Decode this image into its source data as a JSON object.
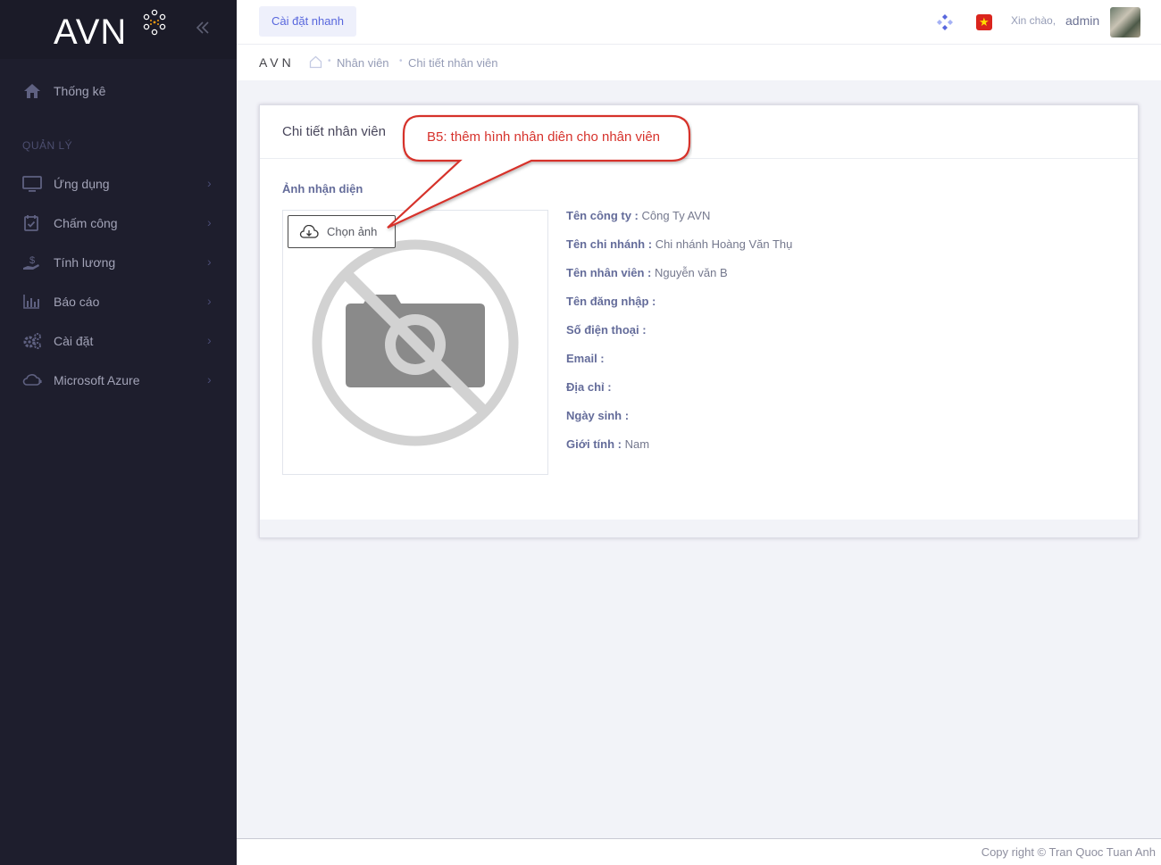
{
  "brand": {
    "name": "AVN"
  },
  "sidebar": {
    "items": [
      {
        "label": "Thống kê",
        "icon": "home-icon"
      },
      {
        "label": "Ứng dụng",
        "icon": "monitor-icon"
      },
      {
        "label": "Chấm công",
        "icon": "calendar-check-icon"
      },
      {
        "label": "Tính lương",
        "icon": "hand-money-icon"
      },
      {
        "label": "Báo cáo",
        "icon": "bar-chart-icon"
      },
      {
        "label": "Cài đặt",
        "icon": "gears-icon"
      },
      {
        "label": "Microsoft Azure",
        "icon": "cloud-icon"
      }
    ],
    "section_label": "QUẢN LÝ"
  },
  "header": {
    "quick_settings": "Cài đặt nhanh",
    "greeting": "Xin chào,",
    "username": "admin"
  },
  "subheader": {
    "title": "AVN",
    "breadcrumbs": [
      "Nhân viên",
      "Chi tiết nhân viên"
    ]
  },
  "portlet": {
    "title": "Chi tiết nhân viên",
    "photo_label": "Ảnh nhận diện",
    "choose_photo": "Chọn ảnh",
    "fields": [
      {
        "key": "Tên công ty :",
        "value": "Công Ty AVN"
      },
      {
        "key": "Tên chi nhánh :",
        "value": "Chi nhánh Hoàng Văn Thụ"
      },
      {
        "key": "Tên nhân viên :",
        "value": "Nguyễn văn B"
      },
      {
        "key": "Tên đăng nhập :",
        "value": ""
      },
      {
        "key": "Số điện thoại :",
        "value": ""
      },
      {
        "key": "Email :",
        "value": ""
      },
      {
        "key": "Địa chỉ :",
        "value": ""
      },
      {
        "key": "Ngày sinh :",
        "value": ""
      },
      {
        "key": "Giới tính :",
        "value": "Nam"
      }
    ]
  },
  "callout": {
    "text": "B5: thêm hình nhân diên cho nhân viên"
  },
  "footer": {
    "text": "Copy right  ©  Tran Quoc Tuan Anh"
  },
  "colors": {
    "sidebar": "#1e1e2d",
    "accent": "#5867dd",
    "callout": "#d6322c"
  }
}
